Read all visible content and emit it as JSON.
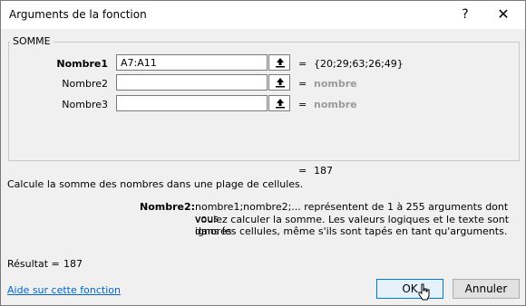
{
  "window": {
    "title": "Arguments de la fonction",
    "help_glyph": "?",
    "close_glyph": "✕"
  },
  "function": {
    "name": "SOMME",
    "arguments": [
      {
        "label": "Nombre1",
        "value": "A7:A11",
        "result": "{20;29;63;26;49}"
      },
      {
        "label": "Nombre2",
        "value": "",
        "result": "nombre"
      },
      {
        "label": "Nombre3",
        "value": "",
        "result": "nombre"
      }
    ],
    "equals": "=",
    "formula_result": "187",
    "description": "Calcule la somme des nombres dans une plage de cellules.",
    "arg_help_label": "Nombre2:",
    "arg_help_lines": [
      "nombre1;nombre2;... représentent de 1 à 255 arguments dont vous",
      "voulez calculer la somme. Les valeurs logiques et le texte sont ignorés",
      "dans les cellules, même s'ils sont tapés en tant qu'arguments."
    ]
  },
  "footer": {
    "result_label": "Résultat =",
    "result_value": "187",
    "help_link": "Aide sur cette fonction",
    "ok_label": "OK",
    "cancel_label": "Annuler"
  }
}
